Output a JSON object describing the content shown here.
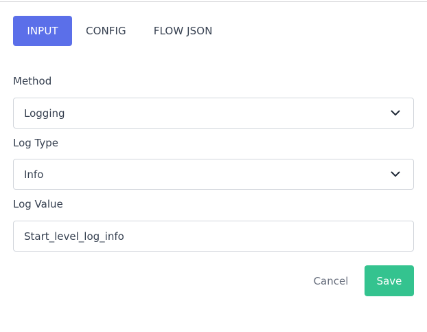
{
  "tabs": [
    {
      "label": "INPUT",
      "active": true
    },
    {
      "label": "CONFIG",
      "active": false
    },
    {
      "label": "FLOW JSON",
      "active": false
    }
  ],
  "form": {
    "method": {
      "label": "Method",
      "value": "Logging"
    },
    "log_type": {
      "label": "Log Type",
      "value": "Info"
    },
    "log_value": {
      "label": "Log Value",
      "value": "Start_level_log_info"
    }
  },
  "actions": {
    "cancel_label": "Cancel",
    "save_label": "Save"
  },
  "colors": {
    "active_tab": "#5b6fe9",
    "save_button": "#34c38f"
  },
  "icons": {
    "select_chevron": "chevron-down-icon"
  }
}
